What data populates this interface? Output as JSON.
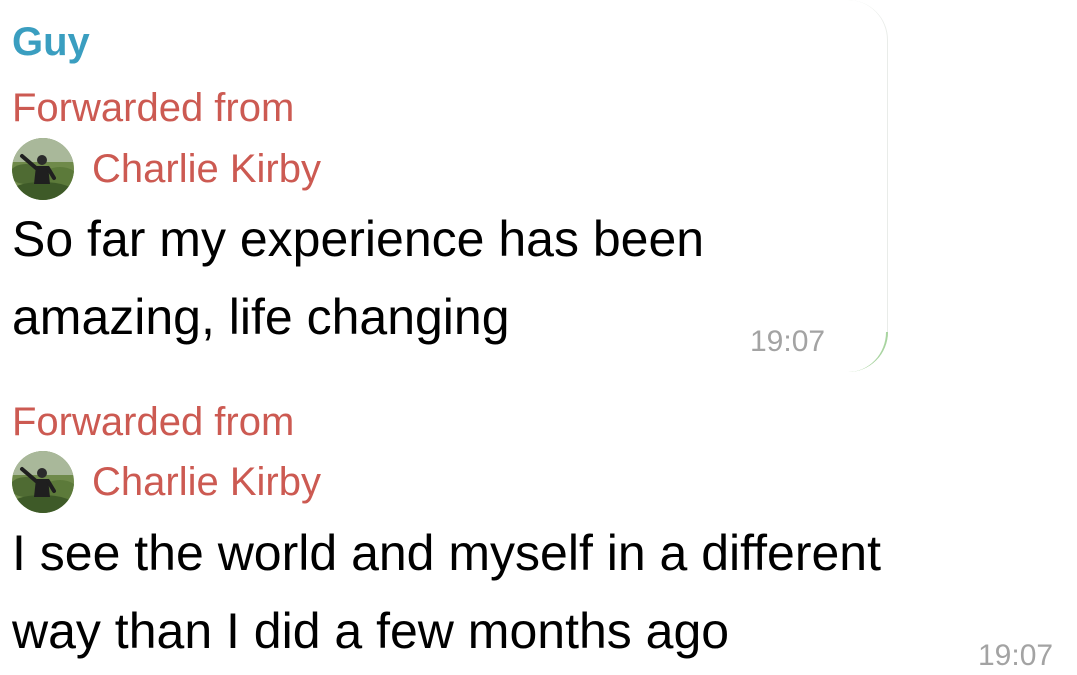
{
  "chat": {
    "sender_name": "Guy",
    "messages": [
      {
        "forwarded_label": "Forwarded from",
        "forwarded_author": "Charlie Kirby",
        "line1": "So far my experience has been",
        "line2": "amazing, life changing",
        "time": "19:07"
      },
      {
        "forwarded_label": "Forwarded from",
        "forwarded_author": "Charlie Kirby",
        "line1": "I see the world and myself in a different",
        "line2": "way than I did a few months ago",
        "time": "19:07"
      }
    ]
  },
  "colors": {
    "sender": "#3a9ec0",
    "forwarded": "#cc5a52",
    "text": "#000000",
    "timestamp": "#a3a3a3"
  }
}
